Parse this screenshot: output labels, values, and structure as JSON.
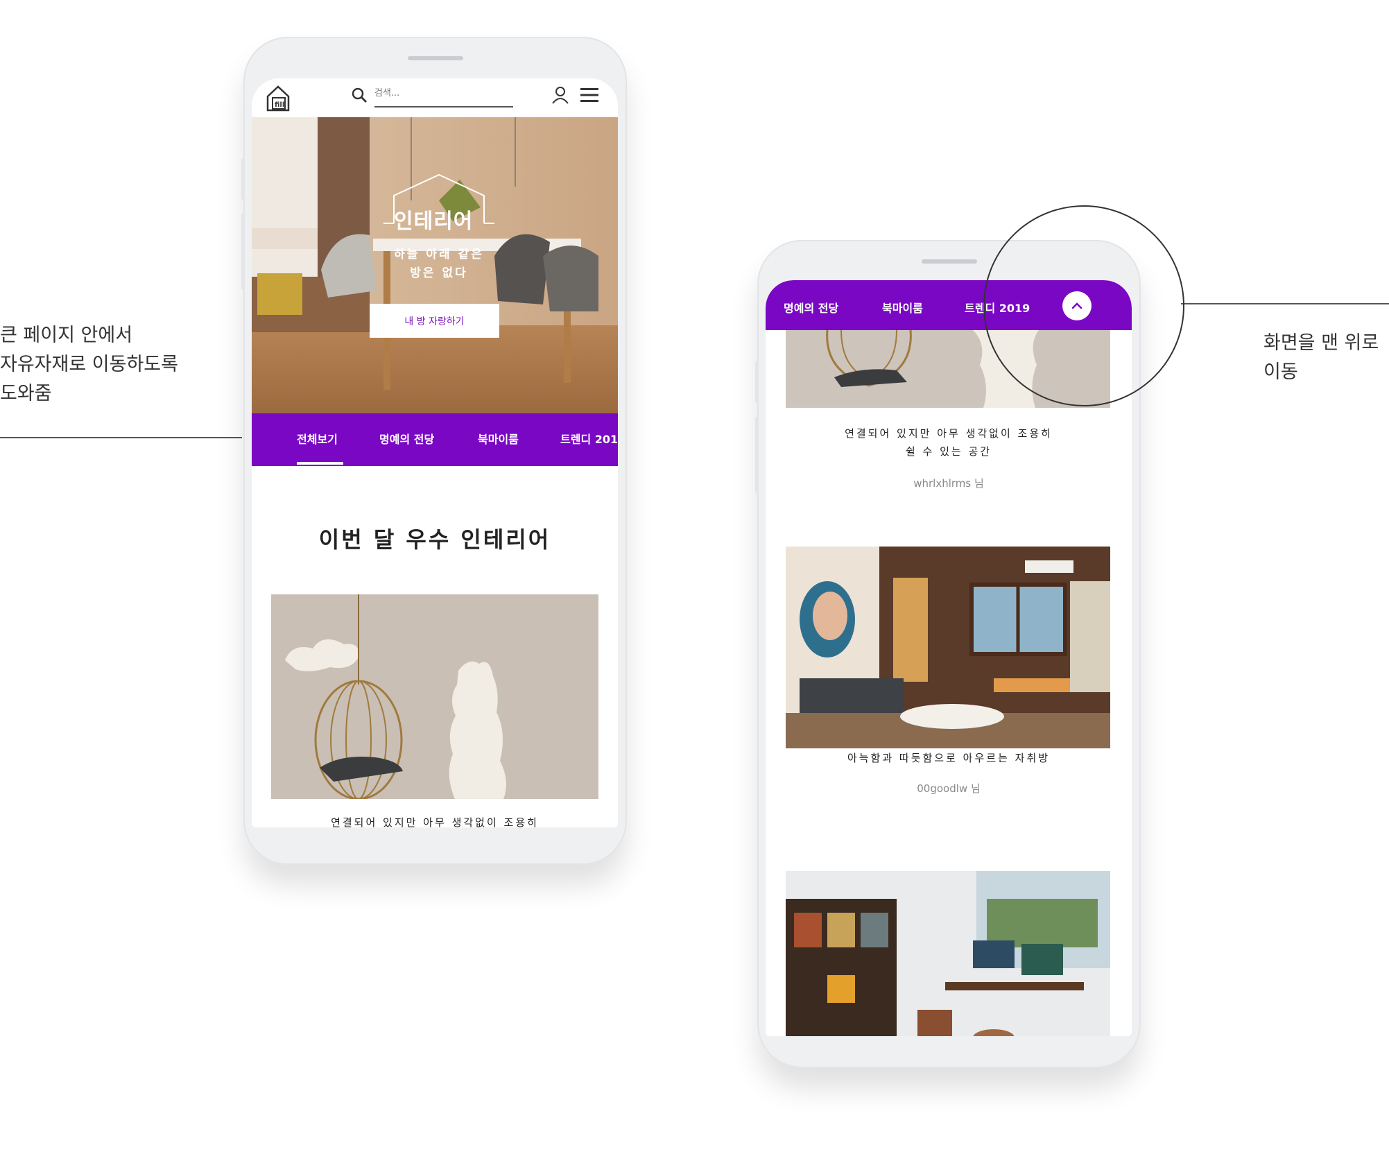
{
  "annotations": {
    "left_text": "큰 페이지 안에서\n자유자재로 이동하도록\n도와줌",
    "left_lines": [
      "큰 페이지 안에서",
      "자유자재로 이동하도록",
      "도와줌"
    ],
    "right_lines": [
      "화면을 맨 위로",
      "이동"
    ]
  },
  "phone1": {
    "search": {
      "placeholder": "검색..."
    },
    "hero": {
      "title": "인테리어",
      "subtitle_line1": "하늘 아래 같은",
      "subtitle_line2": "방은 없다",
      "button_label": "내 방 자랑하기"
    },
    "tabs": [
      "전체보기",
      "명예의 전당",
      "북마이룸",
      "트렌디 2019"
    ],
    "active_tab": "전체보기",
    "section_title": "이번 달 우수 인테리어",
    "card_title_partial": "연결되어 있지만 아무 생각없이 조용히"
  },
  "phone2": {
    "tabs": [
      "명예의 전당",
      "북마이룸",
      "트렌디 2019"
    ],
    "cards": [
      {
        "title_line1": "연결되어 있지만 아무 생각없이 조용히",
        "title_line2": "쉴 수 있는 공간",
        "author": "whrlxhlrms 님"
      },
      {
        "title_line1": "아늑함과 따듯함으로 아우르는 자취방",
        "author": "00goodlw 님"
      }
    ]
  },
  "colors": {
    "accent": "#7a07c4",
    "background": "#ffffff"
  },
  "icons": [
    "logo-icon",
    "search-icon",
    "user-icon",
    "menu-icon",
    "chevron-up-icon"
  ]
}
